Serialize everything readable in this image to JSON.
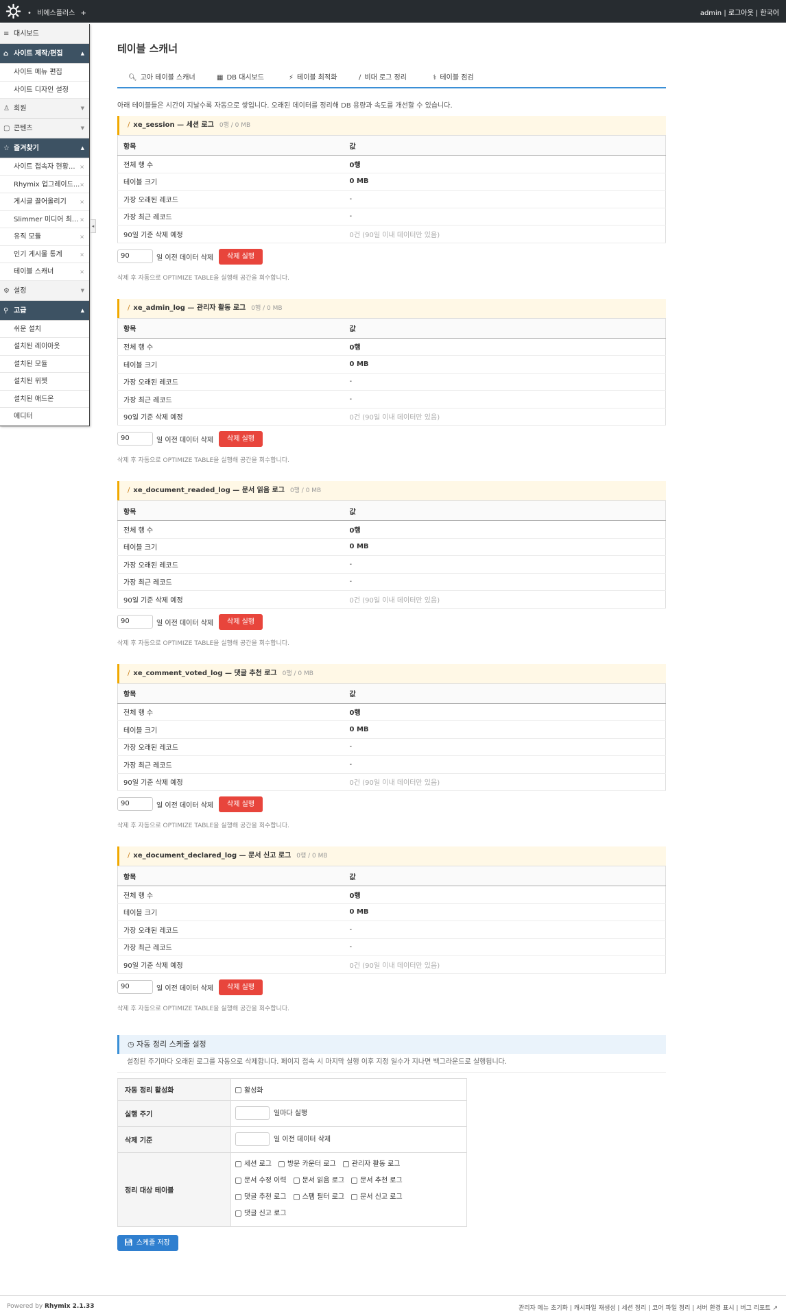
{
  "topbar": {
    "site_name": "비에스플러스",
    "right_text": "admin | 로그아웃 | 한국어"
  },
  "sidebar": {
    "dashboard": "대시보드",
    "groups": [
      {
        "label": "사이트 제작/편집",
        "icon": "home-icon",
        "glyph": "⌂",
        "expanded": true,
        "items": [
          "사이트 메뉴 편집",
          "사이트 디자인 설정"
        ],
        "closable": false
      },
      {
        "label": "회원",
        "icon": "users-icon",
        "glyph": "♙",
        "expanded": false,
        "items": [],
        "closable": false
      },
      {
        "label": "콘텐츠",
        "icon": "content-icon",
        "glyph": "▢",
        "expanded": false,
        "items": [],
        "closable": false
      },
      {
        "label": "즐겨찾기",
        "icon": "star-icon",
        "glyph": "☆",
        "expanded": true,
        "items": [
          "사이트 접속자 현황...",
          "Rhymix 업그레이드...",
          "게시글 끌어올리기",
          "Slimmer 미디어 최...",
          "유직 모듈",
          "인기 게시물 통계",
          "테이블 스캐너"
        ],
        "closable": true
      },
      {
        "label": "설정",
        "icon": "gear-icon",
        "glyph": "⚙",
        "expanded": false,
        "items": [],
        "closable": false
      },
      {
        "label": "고급",
        "icon": "pin-icon",
        "glyph": "⚲",
        "expanded": true,
        "items": [
          "쉬운 설치",
          "설치된 레이아웃",
          "설치된 모듈",
          "설치된 위젯",
          "설치된 애드온",
          "에디터"
        ],
        "closable": false
      }
    ]
  },
  "main": {
    "title": "테이블 스캐너",
    "tabs": [
      {
        "label": "고아 테이블 스캐너",
        "icon": "search-icon",
        "glyph": "🔍︎"
      },
      {
        "label": "DB 대시보드",
        "icon": "chart-icon",
        "glyph": "▦"
      },
      {
        "label": "테이블 최적화",
        "icon": "bolt-icon",
        "glyph": "⚡︎"
      },
      {
        "label": "비대 로그 정리",
        "icon": "brush-icon",
        "glyph": "∕"
      },
      {
        "label": "테이블 점검",
        "icon": "stethoscope-icon",
        "glyph": "⚕︎"
      }
    ],
    "description": "아래 테이블들은 시간이 지날수록 자동으로 쌓입니다. 오래된 데이터를 정리해 DB 용량과 속도를 개선할 수 있습니다.",
    "table_headers": [
      "항목",
      "값"
    ],
    "row_labels": [
      "전체 행 수",
      "테이블 크기",
      "가장 오래된 레코드",
      "가장 최근 레코드",
      "90일 기준 삭제 예정"
    ],
    "delete_label": "일 이전 데이터 삭제",
    "delete_button": "삭제 실행",
    "note": "삭제 후 자동으로 OPTIMIZE TABLE을 실행해 공간을 회수합니다.",
    "sections": [
      {
        "name": "xe_session — 세션 로그",
        "meta": "0행 / 0 MB",
        "days": "90",
        "values": [
          "0행",
          "0 MB",
          "-",
          "-",
          "0건 (90일 이내 데이터만 있음)"
        ]
      },
      {
        "name": "xe_admin_log — 관리자 활동 로그",
        "meta": "0행 / 0 MB",
        "days": "90",
        "values": [
          "0행",
          "0 MB",
          "-",
          "-",
          "0건 (90일 이내 데이터만 있음)"
        ]
      },
      {
        "name": "xe_document_readed_log — 문서 읽음 로그",
        "meta": "0행 / 0 MB",
        "days": "90",
        "values": [
          "0행",
          "0 MB",
          "-",
          "-",
          "0건 (90일 이내 데이터만 있음)"
        ]
      },
      {
        "name": "xe_comment_voted_log — 댓글 추천 로그",
        "meta": "0행 / 0 MB",
        "days": "90",
        "values": [
          "0행",
          "0 MB",
          "-",
          "-",
          "0건 (90일 이내 데이터만 있음)"
        ]
      },
      {
        "name": "xe_document_declared_log — 문서 신고 로그",
        "meta": "0행 / 0 MB",
        "days": "90",
        "values": [
          "0행",
          "0 MB",
          "-",
          "-",
          "0건 (90일 이내 데이터만 있음)"
        ]
      }
    ],
    "schedule": {
      "title": "자동 정리 스케줄 설정",
      "description": "설정된 주기마다 오래된 로그를 자동으로 삭제합니다. 페이지 접속 시 마지막 실행 이후 지정 일수가 지나면 백그라운드로 실행됩니다.",
      "enable_label": "자동 정리 활성화",
      "enable_checkbox": "활성화",
      "interval_label": "실행 주기",
      "interval_suffix": "일마다 실행",
      "interval_value": "",
      "criteria_label": "삭제 기준",
      "criteria_suffix": "일 이전 데이터 삭제",
      "criteria_value": "",
      "targets_label": "정리 대상 테이블",
      "targets": [
        [
          "세션 로그",
          "방문 카운터 로그",
          "관리자 활동 로그"
        ],
        [
          "문서 수정 이력",
          "문서 읽음 로그",
          "문서 추천 로그"
        ],
        [
          "댓글 추천 로그",
          "스팸 필터 로그",
          "문서 신고 로그"
        ],
        [
          "댓글 신고 로그"
        ]
      ],
      "save_button": "스케줄 저장"
    }
  },
  "footer": {
    "powered_prefix": "Powered by",
    "powered_brand": "Rhymix 2.1.33",
    "links": "관리자 메뉴 초기화 | 캐시파일 재생성 | 세션 정리 | 코어 파일 정리 | 서버 환경 표시 | 버그 리포트 ↗"
  }
}
